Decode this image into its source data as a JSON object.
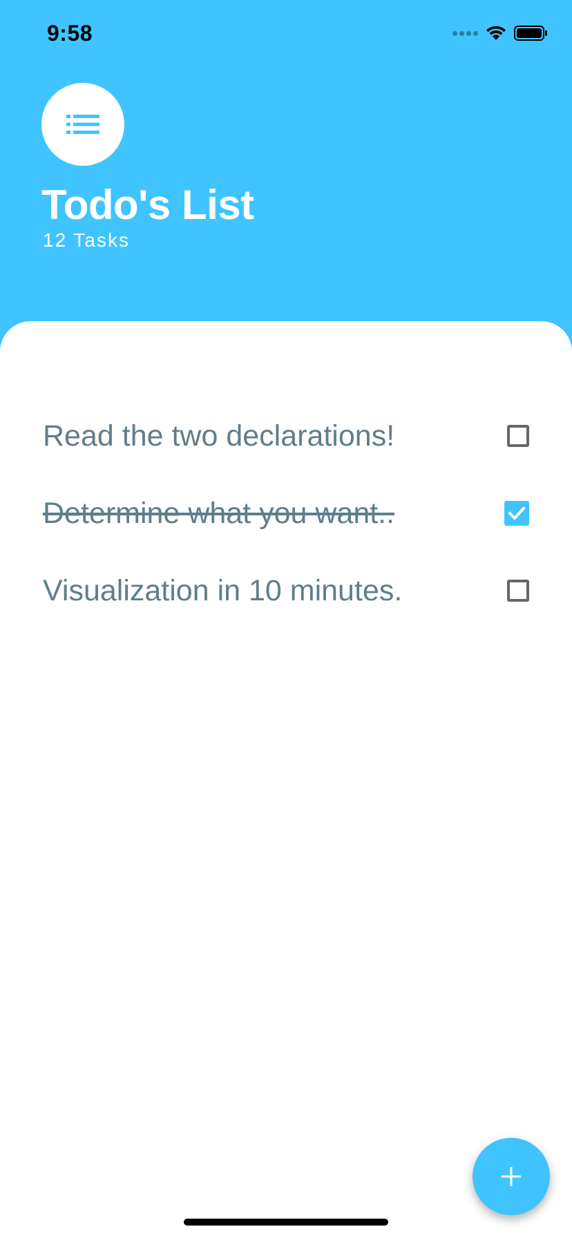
{
  "status_bar": {
    "time": "9:58"
  },
  "header": {
    "title": "Todo's List",
    "task_count": "12 Tasks",
    "icon": "list-icon"
  },
  "todos": [
    {
      "text": "Read the two declarations!",
      "checked": false
    },
    {
      "text": "Determine what you want..",
      "checked": true
    },
    {
      "text": "Visualization in 10 minutes.",
      "checked": false
    }
  ],
  "fab": {
    "icon": "plus-icon"
  },
  "colors": {
    "accent": "#40C4FF",
    "text": "#607D8B",
    "background": "#FFFFFF"
  }
}
